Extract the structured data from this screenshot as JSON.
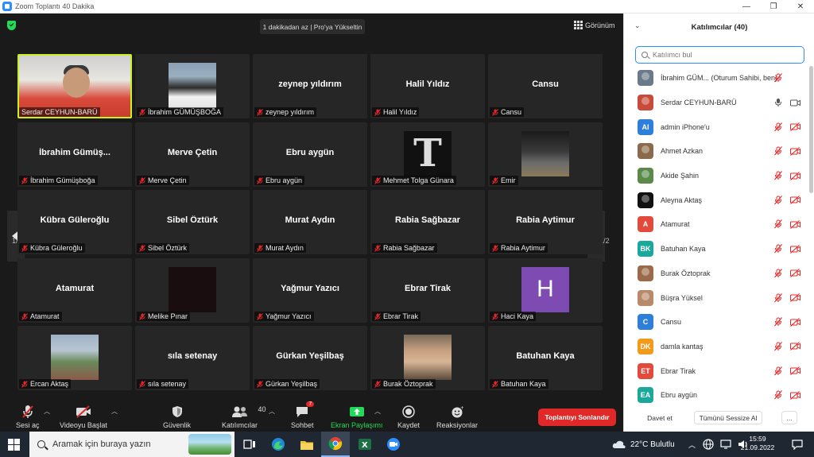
{
  "window": {
    "title": "Zoom Toplantı 40 Dakika",
    "controls": [
      "—",
      "❐",
      "✕"
    ]
  },
  "top_banner": "1 dakikadan az | Pro'ya Yükseltin",
  "view_button": "Görünüm",
  "tiles": [
    {
      "label": "Serdar CEYHUN-BARÜ",
      "big": "",
      "photo": "serdar",
      "active": true
    },
    {
      "label": "İbrahim GÜMÜŞBOĞA",
      "big": "",
      "photo": "ibrahim"
    },
    {
      "label": "zeynep yıldırım",
      "big": "zeynep yıldırım"
    },
    {
      "label": "Halil Yıldız",
      "big": "Halil Yıldız"
    },
    {
      "label": "Cansu",
      "big": "Cansu"
    },
    {
      "label": "İbrahim Gümüşboğa",
      "big": "İbrahim  Gümüş..."
    },
    {
      "label": "Merve Çetin",
      "big": "Merve Çetin"
    },
    {
      "label": "Ebru aygün",
      "big": "Ebru aygün"
    },
    {
      "label": "Mehmet Tolga Günara",
      "big": "",
      "photo": "tolga",
      "photo_text": "T"
    },
    {
      "label": "Emir",
      "big": "",
      "photo": "emir"
    },
    {
      "label": "Kübra Güleroğlu",
      "big": "Kübra Güleroğlu"
    },
    {
      "label": "Sibel Öztürk",
      "big": "Sibel Öztürk"
    },
    {
      "label": "Murat Aydın",
      "big": "Murat Aydın"
    },
    {
      "label": "Rabia Sağbazar",
      "big": "Rabia Sağbazar"
    },
    {
      "label": "Rabia Aytimur",
      "big": "Rabia Aytimur"
    },
    {
      "label": "Atamurat",
      "big": "Atamurat"
    },
    {
      "label": "Melike Pınar",
      "big": "",
      "photo": "melike"
    },
    {
      "label": "Yağmur Yazıcı",
      "big": "Yağmur Yazıcı"
    },
    {
      "label": "Ebrar Tirak",
      "big": "Ebrar Tirak"
    },
    {
      "label": "Haci Kaya",
      "big": "",
      "photo": "haci",
      "photo_text": "H"
    },
    {
      "label": "Ercan Aktaş",
      "big": "",
      "photo": "ercan"
    },
    {
      "label": "sıla setenay",
      "big": "sıla setenay"
    },
    {
      "label": "Gürkan Yeşilbaş",
      "big": "Gürkan Yeşilbaş"
    },
    {
      "label": "Burak Öztoprak",
      "big": "",
      "photo": "burak"
    },
    {
      "label": "Batuhan Kaya",
      "big": "Batuhan Kaya"
    }
  ],
  "pager": {
    "left": "1/2",
    "right": "1/2"
  },
  "toolbar": {
    "mute": "Sesi aç",
    "video": "Videoyu Başlat",
    "security": "Güvenlik",
    "participants": "Katılımcılar",
    "participants_count": "40",
    "chat": "Sohbet",
    "chat_badge": "7",
    "share": "Ekran Paylaşımı",
    "record": "Kaydet",
    "reactions": "Reaksiyonlar",
    "end": "Toplantıyı Sonlandır"
  },
  "panel": {
    "title": "Katılımcılar (40)",
    "search_placeholder": "Katılımcı bul",
    "participants": [
      {
        "name": "İbrahim GÜM...  (Oturum Sahibi, ben)",
        "avatar": "photo",
        "avatar_color": "#6a7a8a",
        "mic": "muted",
        "video": "none"
      },
      {
        "name": "Serdar CEYHUN-BARÜ",
        "avatar": "photo",
        "avatar_color": "#c84a3a",
        "mic": "on",
        "video": "on"
      },
      {
        "name": "admin iPhone'u",
        "initials": "AI",
        "avatar_color": "#2e7fd9",
        "mic": "muted",
        "video": "off"
      },
      {
        "name": "Ahmet Azkan",
        "avatar": "photo",
        "avatar_color": "#8a6a4a",
        "mic": "muted",
        "video": "off"
      },
      {
        "name": "Akide Şahin",
        "avatar": "photo",
        "avatar_color": "#5a8a4a",
        "mic": "muted",
        "video": "off"
      },
      {
        "name": "Aleyna Aktaş",
        "avatar": "photo",
        "avatar_color": "#111111",
        "mic": "muted",
        "video": "off"
      },
      {
        "name": "Atamurat",
        "initials": "A",
        "avatar_color": "#e24b3b",
        "mic": "muted",
        "video": "off"
      },
      {
        "name": "Batuhan Kaya",
        "initials": "BK",
        "avatar_color": "#1aa89a",
        "mic": "muted",
        "video": "off"
      },
      {
        "name": "Burak Öztoprak",
        "avatar": "photo",
        "avatar_color": "#9a6a4a",
        "mic": "muted",
        "video": "off"
      },
      {
        "name": "Büşra Yüksel",
        "avatar": "photo",
        "avatar_color": "#b88a6a",
        "mic": "muted",
        "video": "off"
      },
      {
        "name": "Cansu",
        "initials": "C",
        "avatar_color": "#2e7fd9",
        "mic": "muted",
        "video": "off"
      },
      {
        "name": "damla kantaş",
        "initials": "DK",
        "avatar_color": "#f29a1a",
        "mic": "muted",
        "video": "off"
      },
      {
        "name": "Ebrar Tirak",
        "initials": "ET",
        "avatar_color": "#e24b3b",
        "mic": "muted",
        "video": "off"
      },
      {
        "name": "Ebru aygün",
        "initials": "EA",
        "avatar_color": "#1aa89a",
        "mic": "muted",
        "video": "off"
      }
    ],
    "invite": "Davet et",
    "mute_all": "Tümünü Sessize Al",
    "more": "..."
  },
  "taskbar": {
    "search_placeholder": "Aramak için buraya yazın",
    "weather": "22°C  Bulutlu",
    "time": "15:59",
    "date": "21.09.2022"
  },
  "colors": {
    "accent": "#2d8cff",
    "end_red": "#e02828",
    "active_speaker": "#c8f024",
    "share_green": "#23d959",
    "mute_red": "#e02828"
  }
}
